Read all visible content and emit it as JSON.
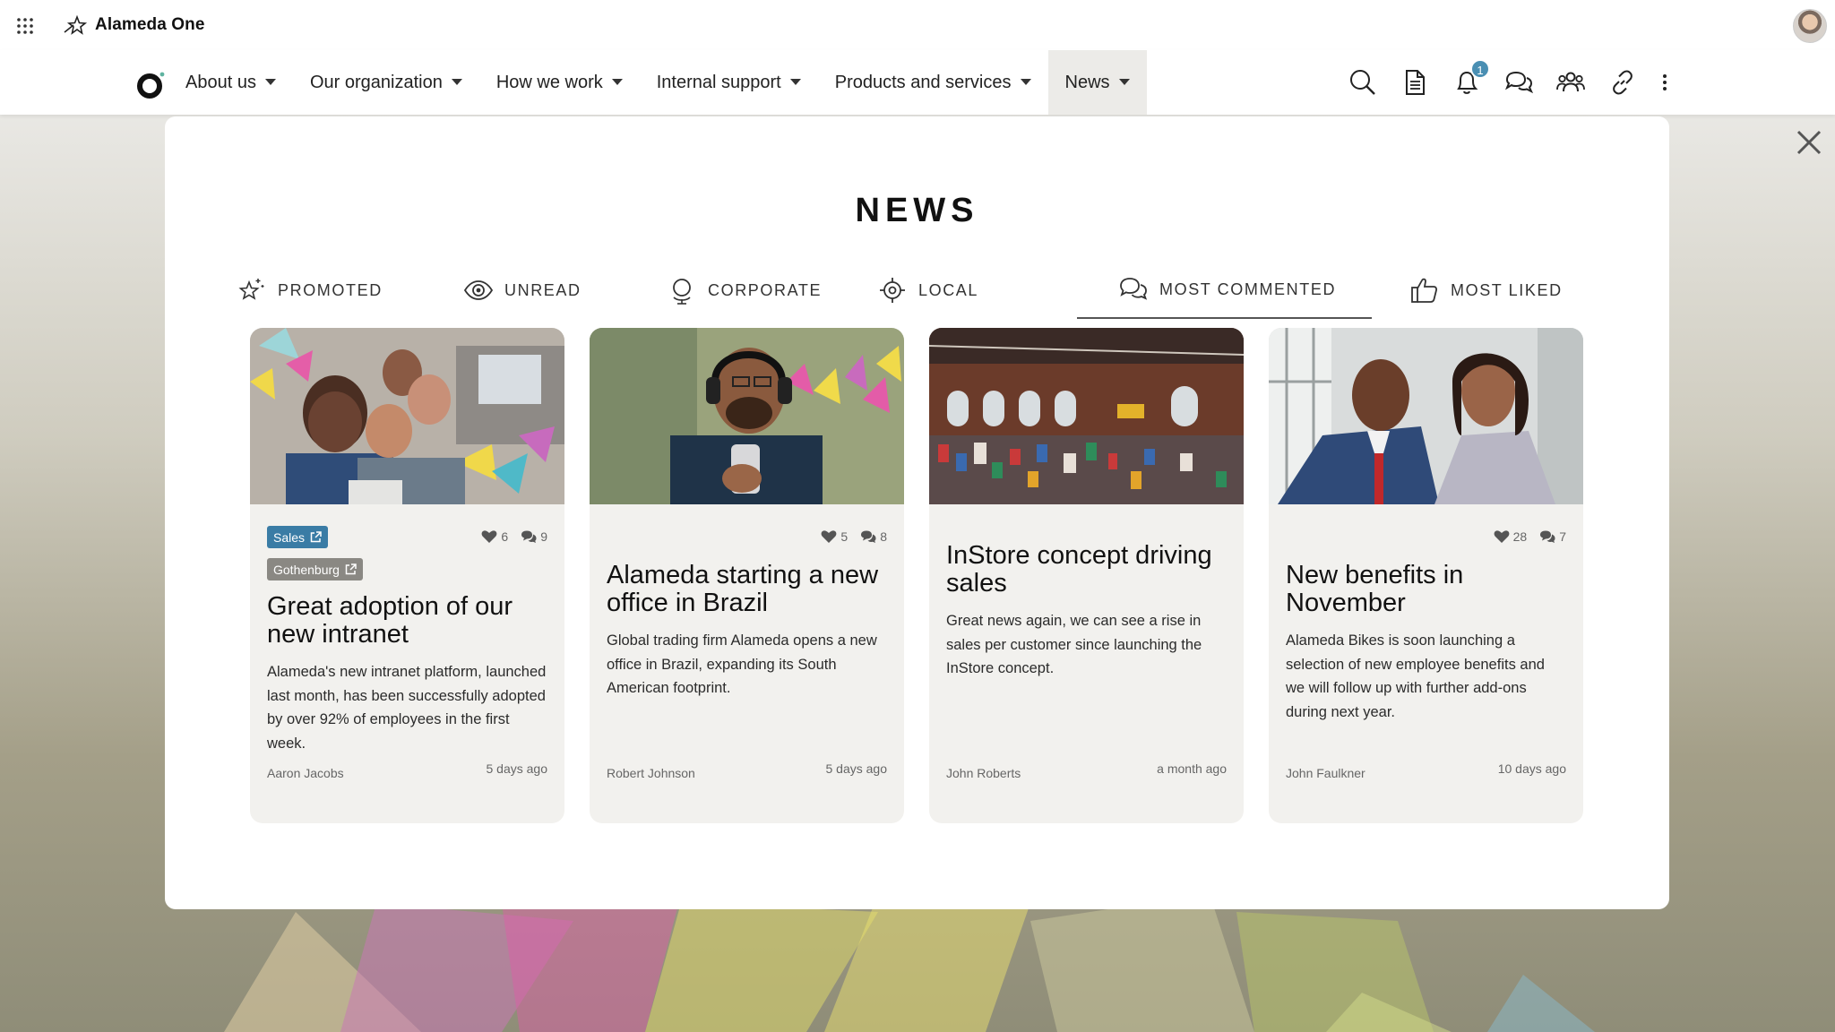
{
  "app": {
    "name": "Alameda One"
  },
  "nav": {
    "items": [
      {
        "label": "About us"
      },
      {
        "label": "Our organization"
      },
      {
        "label": "How we work"
      },
      {
        "label": "Internal support"
      },
      {
        "label": "Products and services"
      },
      {
        "label": "News"
      }
    ],
    "active": "News",
    "icons": [
      "search-icon",
      "document-icon",
      "bell-icon",
      "chat-icon",
      "people-icon",
      "link-icon",
      "more-icon"
    ],
    "notification_count": "1"
  },
  "news": {
    "title": "NEWS",
    "tabs": [
      {
        "label": "PROMOTED",
        "icon": "star-sparkle-icon"
      },
      {
        "label": "UNREAD",
        "icon": "eye-icon"
      },
      {
        "label": "CORPORATE",
        "icon": "globe-icon"
      },
      {
        "label": "LOCAL",
        "icon": "location-target-icon"
      },
      {
        "label": "MOST COMMENTED",
        "icon": "comments-icon"
      },
      {
        "label": "MOST LIKED",
        "icon": "thumbs-up-icon"
      }
    ],
    "active_tab": "MOST COMMENTED",
    "cards": [
      {
        "tags": [
          "Sales",
          "Gothenburg"
        ],
        "likes": "6",
        "comments": "9",
        "title": "Great adoption of our new intranet",
        "text": "Alameda's new intranet platform, launched last month, has been successfully adopted by over 92% of employees in the first week.",
        "author": "Aaron Jacobs",
        "date": "5 days ago"
      },
      {
        "tags": [],
        "likes": "5",
        "comments": "8",
        "title": "Alameda starting a new office in Brazil",
        "text": "Global trading firm Alameda opens a new office in Brazil, expanding its South American footprint.",
        "author": "Robert Johnson",
        "date": "5 days ago"
      },
      {
        "tags": [],
        "likes": "",
        "comments": "",
        "title": "InStore concept driving sales",
        "text": "Great news again, we can see a rise in sales per customer since launching the InStore concept.",
        "author": "John Roberts",
        "date": "a month ago"
      },
      {
        "tags": [],
        "likes": "28",
        "comments": "7",
        "title": "New benefits in November",
        "text": "Alameda Bikes is soon launching a selection of new employee benefits and we will follow up with further add-ons during next year.",
        "author": "John Faulkner",
        "date": "10 days ago"
      }
    ]
  },
  "colors": {
    "tag_sales": "#3a7ca5",
    "tag_location": "#8a8883",
    "badge": "#4a8fb3"
  }
}
